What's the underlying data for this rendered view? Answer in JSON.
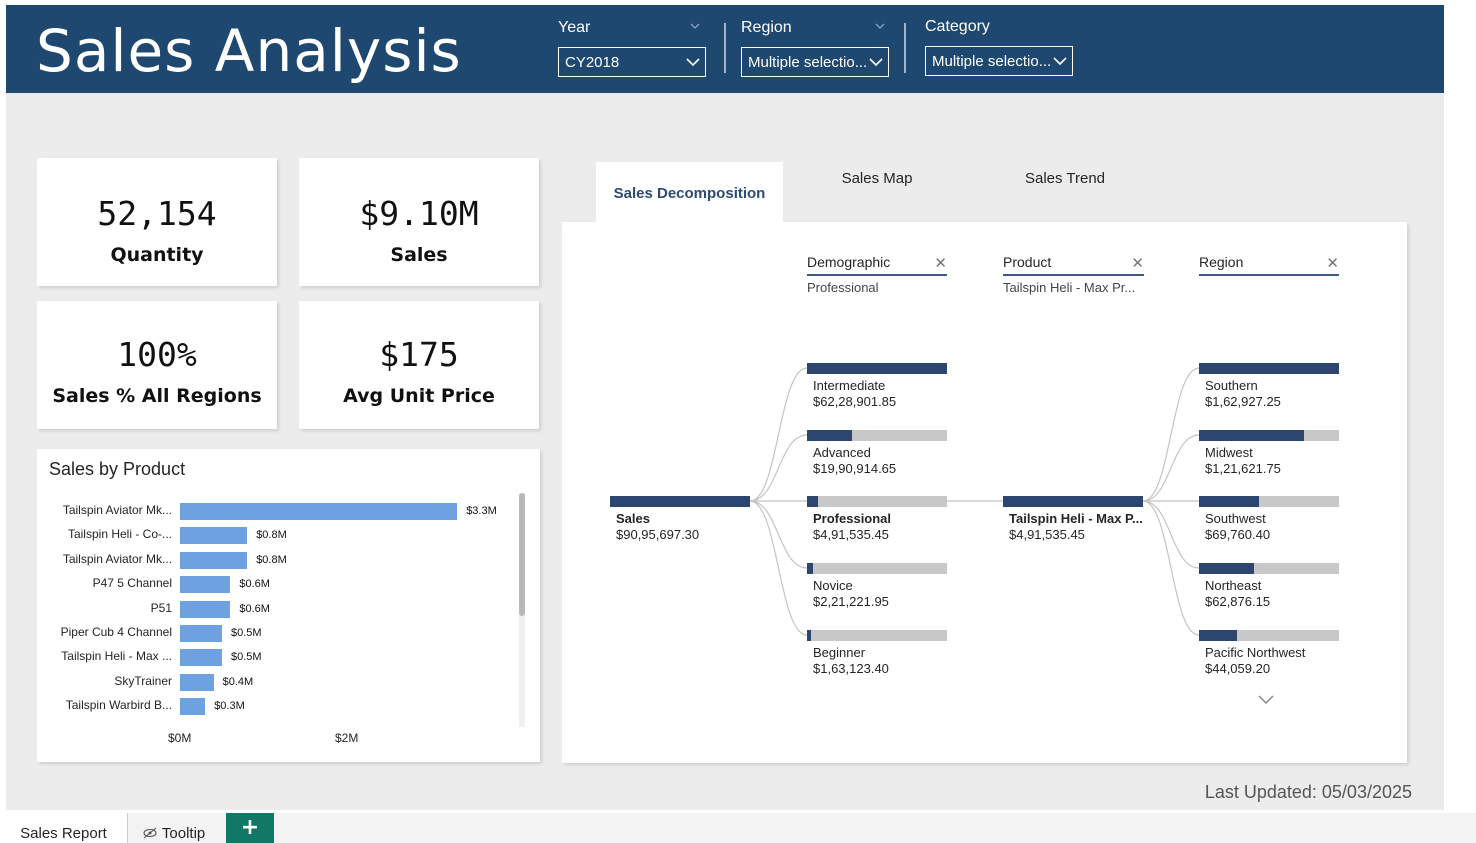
{
  "header": {
    "title": "Sales Analysis",
    "slicers": [
      {
        "label": "Year",
        "value": "CY2018"
      },
      {
        "label": "Region",
        "value": "Multiple selectio..."
      },
      {
        "label": "Category",
        "value": "Multiple selectio..."
      }
    ]
  },
  "kpis": [
    {
      "value": "52,154",
      "caption": "Quantity"
    },
    {
      "value": "$9.10M",
      "caption": "Sales"
    },
    {
      "value": "100%",
      "caption": "Sales % All Regions"
    },
    {
      "value": "$175",
      "caption": "Avg Unit Price"
    }
  ],
  "sales_by_product": {
    "title": "Sales by Product",
    "x_ticks": [
      "$0M",
      "$2M"
    ],
    "chart_data": {
      "type": "bar",
      "orientation": "horizontal",
      "title": "Sales by Product",
      "categories": [
        "Tailspin Aviator Mk...",
        "Tailspin Heli - Co-...",
        "Tailspin Aviator Mk...",
        "P47 5 Channel",
        "P51",
        "Piper Cub 4 Channel",
        "Tailspin Heli - Max ...",
        "SkyTrainer",
        "Tailspin Warbird B..."
      ],
      "values": [
        3.3,
        0.8,
        0.8,
        0.6,
        0.6,
        0.5,
        0.5,
        0.4,
        0.3
      ],
      "data_labels": [
        "$3.3M",
        "$0.8M",
        "$0.8M",
        "$0.6M",
        "$0.6M",
        "$0.5M",
        "$0.5M",
        "$0.4M",
        "$0.3M"
      ],
      "x_unit": "$M",
      "x_ticks": [
        "$0M",
        "$2M"
      ],
      "color": "#6ea1e0"
    }
  },
  "tabs": [
    {
      "label": "Sales Decomposition",
      "active": true
    },
    {
      "label": "Sales Map",
      "active": false
    },
    {
      "label": "Sales Trend",
      "active": false
    }
  ],
  "decomposition": {
    "levels": [
      {
        "name": "Demographic",
        "selected": "Professional"
      },
      {
        "name": "Product",
        "selected": "Tailspin Heli - Max Pr..."
      },
      {
        "name": "Region",
        "selected": ""
      }
    ],
    "root": {
      "name": "Sales",
      "value": "$90,95,697.30"
    },
    "demographic": [
      {
        "name": "Intermediate",
        "value": "$62,28,901.85",
        "fraction": 1.0
      },
      {
        "name": "Advanced",
        "value": "$19,90,914.65",
        "fraction": 0.32
      },
      {
        "name": "Professional",
        "value": "$4,91,535.45",
        "fraction": 0.08,
        "selected": true
      },
      {
        "name": "Novice",
        "value": "$2,21,221.95",
        "fraction": 0.04
      },
      {
        "name": "Beginner",
        "value": "$1,63,123.40",
        "fraction": 0.03
      }
    ],
    "product": {
      "name": "Tailspin Heli - Max P...",
      "value": "$4,91,535.45",
      "fraction": 1.0
    },
    "region": [
      {
        "name": "Southern",
        "value": "$1,62,927.25",
        "fraction": 1.0
      },
      {
        "name": "Midwest",
        "value": "$1,21,621.75",
        "fraction": 0.75
      },
      {
        "name": "Southwest",
        "value": "$69,760.40",
        "fraction": 0.43
      },
      {
        "name": "Northeast",
        "value": "$62,876.15",
        "fraction": 0.39
      },
      {
        "name": "Pacific Northwest",
        "value": "$44,059.20",
        "fraction": 0.27
      }
    ]
  },
  "footer": {
    "last_updated": "Last Updated: 05/03/2025",
    "page_tabs": [
      "Sales Report",
      "Tooltip"
    ]
  },
  "colors": {
    "header_bg": "#1f4871",
    "bar": "#6ea1e0",
    "decomp_fill": "#2c4670",
    "add_tab": "#117865"
  }
}
